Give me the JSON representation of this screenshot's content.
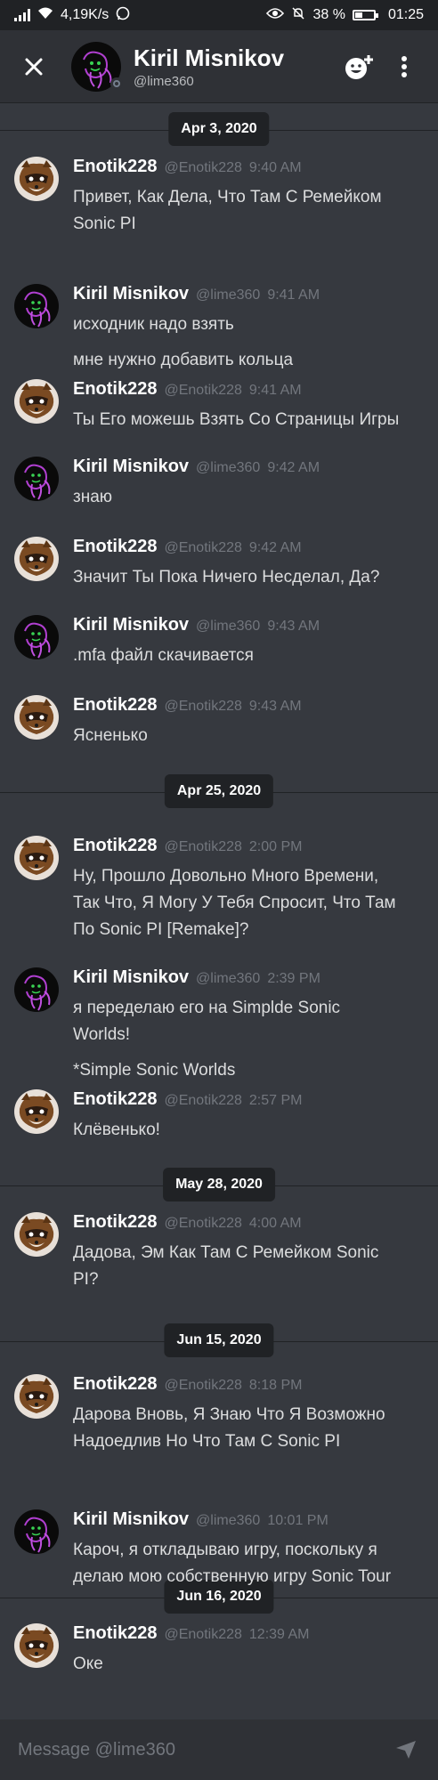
{
  "status_bar": {
    "speed": "4,19K/s",
    "battery": "38 %",
    "time": "01:25"
  },
  "header": {
    "name": "Kiril Misnikov",
    "handle": "@lime360"
  },
  "composer": {
    "placeholder": "Message @lime360"
  },
  "dates": [
    "Apr 3, 2020",
    "Apr 25, 2020",
    "May 28, 2020",
    "Jun 15, 2020",
    "Jun 16, 2020"
  ],
  "messages": [
    {
      "author": "Enotik228",
      "handle": "@Enotik228",
      "time": "9:40 AM",
      "lines": [
        "Привет, Как Дела, Что Там С Ремейком",
        "Sonic PI"
      ]
    },
    {
      "author": "Kiril Misnikov",
      "handle": "@lime360",
      "time": "9:41 AM",
      "lines": [
        "исходник надо взять",
        "мне нужно добавить  кольца"
      ]
    },
    {
      "author": "Enotik228",
      "handle": "@Enotik228",
      "time": "9:41 AM",
      "lines": [
        "Ты Его можешь Взять Со Страницы Игры"
      ]
    },
    {
      "author": "Kiril Misnikov",
      "handle": "@lime360",
      "time": "9:42 AM",
      "lines": [
        "знаю"
      ]
    },
    {
      "author": "Enotik228",
      "handle": "@Enotik228",
      "time": "9:42 AM",
      "lines": [
        "Значит Ты Пока Ничего Несделал, Да?"
      ]
    },
    {
      "author": "Kiril Misnikov",
      "handle": "@lime360",
      "time": "9:43 AM",
      "lines": [
        ".mfa файл скачивается"
      ]
    },
    {
      "author": "Enotik228",
      "handle": "@Enotik228",
      "time": "9:43 AM",
      "lines": [
        "Ясненько"
      ]
    },
    {
      "author": "Enotik228",
      "handle": "@Enotik228",
      "time": "2:00 PM",
      "lines": [
        "Ну, Прошло Довольно Много Времени,",
        "Так Что, Я Могу У Тебя Спросит, Что Там",
        "По Sonic PI [Remake]?"
      ]
    },
    {
      "author": "Kiril Misnikov",
      "handle": "@lime360",
      "time": "2:39 PM",
      "lines": [
        "я переделаю его на Simplde Sonic",
        "Worlds!",
        "*Simple Sonic Worlds"
      ]
    },
    {
      "author": "Enotik228",
      "handle": "@Enotik228",
      "time": "2:57 PM",
      "lines": [
        "Клёвенько!"
      ]
    },
    {
      "author": "Enotik228",
      "handle": "@Enotik228",
      "time": "4:00 AM",
      "lines": [
        "Дадова, Эм Как Там С Ремейком Sonic",
        "PI?"
      ]
    },
    {
      "author": "Enotik228",
      "handle": "@Enotik228",
      "time": "8:18 PM",
      "lines": [
        "Дарова Вновь, Я Знаю Что Я Возможно",
        "Надоедлив Но Что Там С Sonic PI"
      ]
    },
    {
      "author": "Kiril Misnikov",
      "handle": "@lime360",
      "time": "10:01 PM",
      "lines": [
        "Кароч, я откладываю игру, поскольку я",
        "делаю мою собственную игру Sonic Tour"
      ]
    },
    {
      "author": "Enotik228",
      "handle": "@Enotik228",
      "time": "12:39 AM",
      "lines": [
        "Оке"
      ]
    }
  ]
}
